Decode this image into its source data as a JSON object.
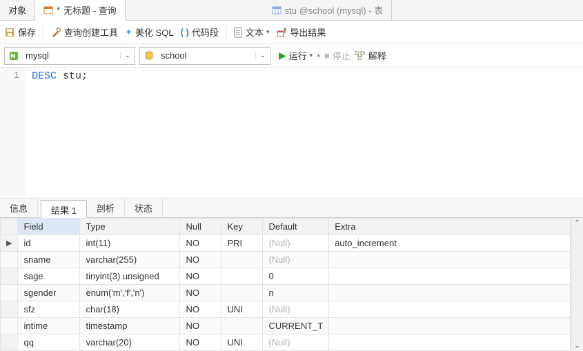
{
  "top_tabs": {
    "object": "对象",
    "query_modified": "*",
    "query_label": "无标题 - 查询",
    "table_label": "stu @school (mysql) - 表"
  },
  "toolbar": {
    "save": "保存",
    "query_builder": "查询创建工具",
    "beautify": "美化 SQL",
    "snippet": "代码段",
    "text": "文本",
    "export": "导出结果"
  },
  "conn": {
    "connection": "mysql",
    "database": "school",
    "run": "运行",
    "stop": "停止",
    "explain": "解释"
  },
  "editor": {
    "line1_no": "1",
    "kw": "DESC",
    "rest": " stu;"
  },
  "result_tabs": {
    "info": "信息",
    "result1": "结果 1",
    "profile": "剖析",
    "status": "状态"
  },
  "grid": {
    "headers": {
      "field": "Field",
      "type": "Type",
      "null": "Null",
      "key": "Key",
      "default": "Default",
      "extra": "Extra"
    },
    "null_label": "(Null)",
    "rows": [
      {
        "field": "id",
        "type": "int(11)",
        "null": "NO",
        "key": "PRI",
        "default": null,
        "extra": "auto_increment"
      },
      {
        "field": "sname",
        "type": "varchar(255)",
        "null": "NO",
        "key": "",
        "default": null,
        "extra": ""
      },
      {
        "field": "sage",
        "type": "tinyint(3) unsigned",
        "null": "NO",
        "key": "",
        "default": "0",
        "extra": ""
      },
      {
        "field": "sgender",
        "type": "enum('m','f','n')",
        "null": "NO",
        "key": "",
        "default": "n",
        "extra": ""
      },
      {
        "field": "sfz",
        "type": "char(18)",
        "null": "NO",
        "key": "UNI",
        "default": null,
        "extra": ""
      },
      {
        "field": "intime",
        "type": "timestamp",
        "null": "NO",
        "key": "",
        "default": "CURRENT_T",
        "extra": ""
      },
      {
        "field": "qq",
        "type": "varchar(20)",
        "null": "NO",
        "key": "UNI",
        "default": null,
        "extra": ""
      }
    ]
  }
}
